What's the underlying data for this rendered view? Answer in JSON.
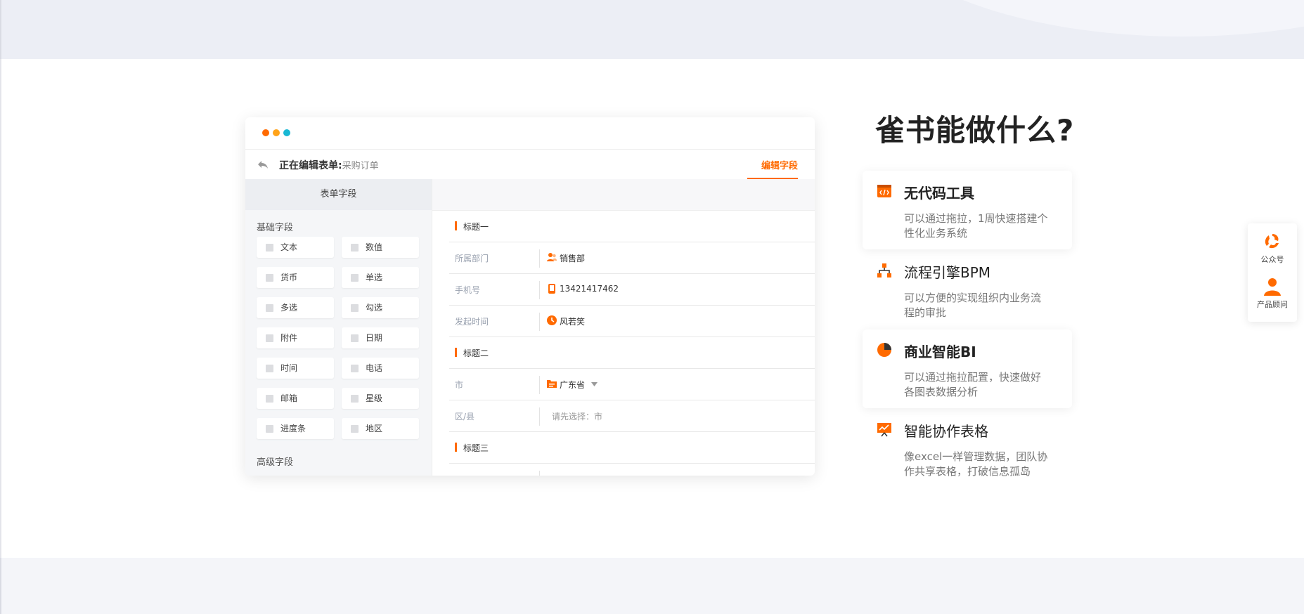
{
  "mock": {
    "editing_label": "正在编辑表单:",
    "editing_value": "采购订单",
    "edit_tab": "编辑字段",
    "left_panel_title": "表单字段",
    "basic_section": "基础字段",
    "advanced_section": "高级字段",
    "fields": [
      "文本",
      "数值",
      "货币",
      "单选",
      "多选",
      "勾选",
      "附件",
      "日期",
      "时间",
      "电话",
      "邮箱",
      "星级",
      "进度条",
      "地区"
    ],
    "groups": [
      "标题一",
      "标题二",
      "标题三"
    ],
    "rows": {
      "dept_label": "所属部门",
      "dept_value": "销售部",
      "phone_label": "手机号",
      "phone_value": "13421417462",
      "time_label": "发起时间",
      "time_value": "风若笑",
      "city_label": "市",
      "city_value": "广东省",
      "county_label": "区/县",
      "county_value": "请先选择：市"
    }
  },
  "headline": "雀书能做什么?",
  "features": [
    {
      "title": "无代码工具",
      "desc": "可以通过拖拉，1周快速搭建个性化业务系统"
    },
    {
      "title": "流程引擎BPM",
      "desc": "可以方便的实现组织内业务流程的审批"
    },
    {
      "title": "商业智能BI",
      "desc": "可以通过拖拉配置，快速做好各图表数据分析"
    },
    {
      "title": "智能协作表格",
      "desc": "像excel一样管理数据，团队协作共享表格，打破信息孤岛"
    }
  ],
  "side_tool": {
    "wechat_label": "公众号",
    "advisor_label": "产品顾问"
  },
  "colors": {
    "accent": "#ff6a00",
    "dot_orange": "#ffa31a",
    "dot_cyan": "#19b8d4"
  }
}
